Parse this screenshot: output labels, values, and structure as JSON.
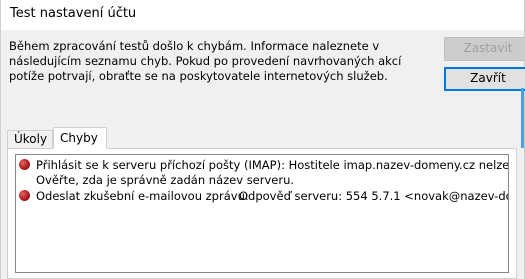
{
  "window": {
    "title": "Test nastavení účtu"
  },
  "info": {
    "text": "Během zpracování testů došlo k chybám. Informace naleznete v následujícím seznamu chyb. Pokud po provedení navrhovaných akcí potíže potrvají, obraťte se na poskytovatele internetových služeb."
  },
  "buttons": {
    "stop_label": "Zastavit",
    "close_label": "Zavřít"
  },
  "tabs": [
    {
      "label": "Úkoly",
      "selected": false
    },
    {
      "label": "Chyby",
      "selected": true
    }
  ],
  "errors": [
    {
      "icon": "error-icon",
      "text": "Přihlásit se k serveru příchozí pošty (IMAP): Hostitele imap.nazev-domeny.cz nelze najít.",
      "detail": "Ověřte, zda je správně zadán název serveru."
    },
    {
      "icon": "error-icon",
      "label": "Odeslat zkušební e-mailovou zprávu:",
      "value": "Odpověď serveru: 554 5.7.1 <novak@nazev-do"
    }
  ],
  "colors": {
    "accent": "#0078d7",
    "error": "#b31b1b",
    "panel": "#f0f0f0"
  }
}
